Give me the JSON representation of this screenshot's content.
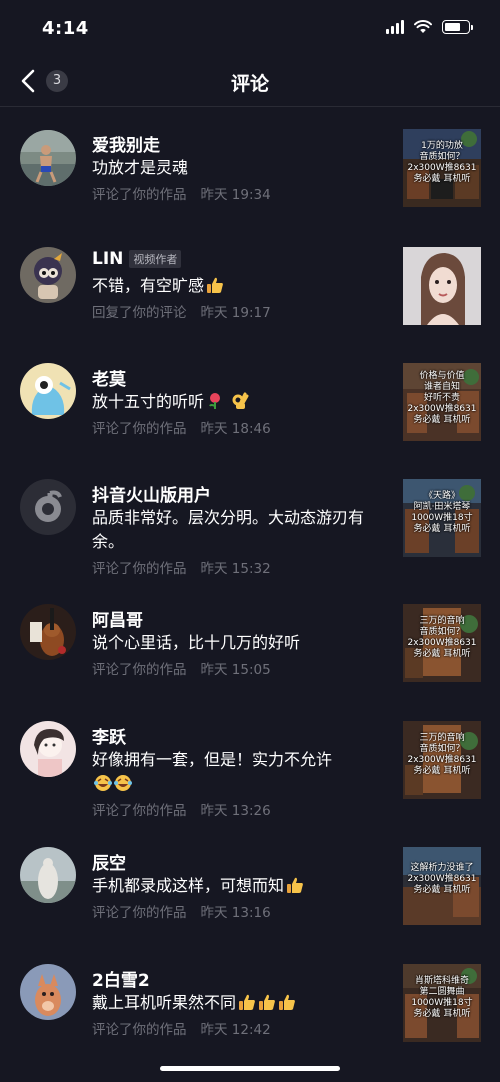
{
  "status_bar": {
    "time": "4:14"
  },
  "nav": {
    "title": "评论",
    "badge": "3"
  },
  "comments": [
    {
      "name": "爱我别走",
      "text": "功放才是灵魂",
      "action": "评论了你的作品",
      "time": "昨天 19:34",
      "thumb_lines": [
        "1万的功放",
        "音质如何？",
        "2x300W推8631",
        "务必戴",
        "耳机听"
      ]
    },
    {
      "name": "LIN",
      "tag": "视频作者",
      "text": "不错，有空旷感",
      "action": "回复了你的评论",
      "time": "昨天 19:17",
      "thumb_lines": []
    },
    {
      "name": "老莫",
      "text": "放十五寸的听听",
      "action": "评论了你的作品",
      "time": "昨天 18:46",
      "thumb_lines": [
        "价格与价值",
        "谁者自知",
        "好听不贵",
        "2x300W推8631",
        "务必戴",
        "耳机听"
      ]
    },
    {
      "name": "抖音火山版用户",
      "text": "品质非常好。层次分明。大动态游刃有余。",
      "action": "评论了你的作品",
      "time": "昨天 15:32",
      "thumb_lines": [
        "《天路》",
        "阿凯·田米塔琴",
        "1000W推18寸",
        "务必戴",
        "耳机听"
      ]
    },
    {
      "name": "阿昌哥",
      "text": "说个心里话，比十几万的好听",
      "action": "评论了你的作品",
      "time": "昨天 15:05",
      "thumb_lines": [
        "三万的音响",
        "音质如何？",
        "2x300W推8631",
        "务必戴",
        "耳机听"
      ]
    },
    {
      "name": "李跃",
      "text": "好像拥有一套，但是！实力不允许",
      "action": "评论了你的作品",
      "time": "昨天 13:26",
      "thumb_lines": [
        "三万的音响",
        "音质如何？",
        "2x300W推8631",
        "务必戴",
        "耳机听"
      ]
    },
    {
      "name": "辰空",
      "text": "手机都录成这样，可想而知",
      "action": "评论了你的作品",
      "time": "昨天 13:16",
      "thumb_lines": [
        "这解析力没谁了",
        "2x300W推8631",
        "务必戴",
        "耳机听"
      ]
    },
    {
      "name": "2白雪2",
      "text": "戴上耳机听果然不同",
      "action": "评论了你的作品",
      "time": "昨天 12:42",
      "thumb_lines": [
        "肖斯塔科维奇",
        "第二圆舞曲",
        "1000W推18寸",
        "务必戴",
        "耳机听"
      ]
    }
  ],
  "icons": {
    "back": "chevron-left-icon",
    "thumbs_up": "thumbs-up-icon",
    "rose": "rose-icon",
    "ok": "ok-hand-icon",
    "laugh": "laugh-cry-icon"
  },
  "colors": {
    "background": "#161722",
    "secondary_text": "#6f707a",
    "tag_bg": "#30313c"
  }
}
